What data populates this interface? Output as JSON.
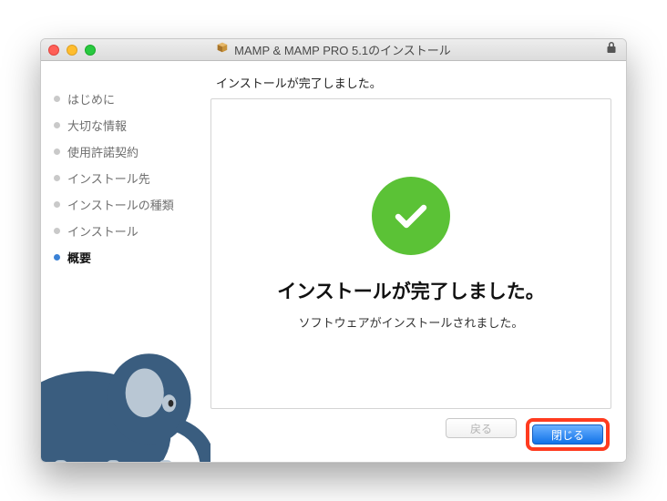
{
  "window": {
    "title": "MAMP & MAMP PRO 5.1のインストール"
  },
  "sidebar": {
    "steps": [
      {
        "label": "はじめに",
        "active": false
      },
      {
        "label": "大切な情報",
        "active": false
      },
      {
        "label": "使用許諾契約",
        "active": false
      },
      {
        "label": "インストール先",
        "active": false
      },
      {
        "label": "インストールの種類",
        "active": false
      },
      {
        "label": "インストール",
        "active": false
      },
      {
        "label": "概要",
        "active": true
      }
    ]
  },
  "main": {
    "header": "インストールが完了しました。",
    "title": "インストールが完了しました。",
    "subtitle": "ソフトウェアがインストールされました。"
  },
  "buttons": {
    "back": "戻る",
    "close": "閉じる"
  }
}
